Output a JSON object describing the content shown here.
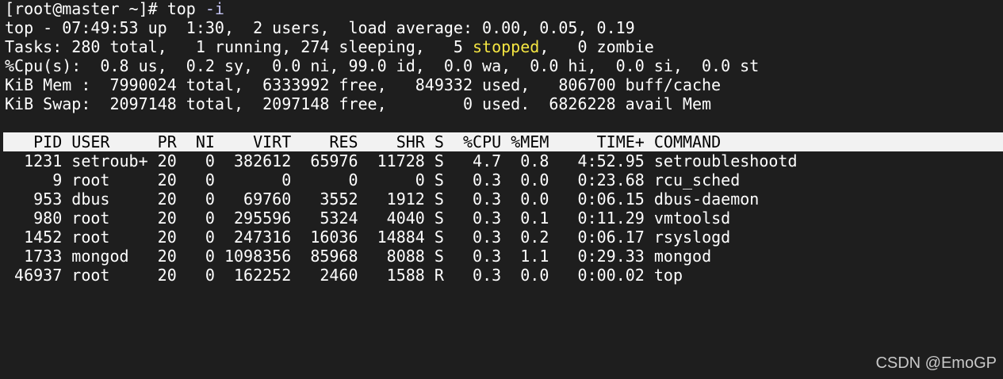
{
  "terminal": {
    "prompt": "[root@master ~]# ",
    "command": "top",
    "command_arg": " -i",
    "summary": {
      "uptime_line": "top - 07:49:53 up  1:30,  2 users,  load average: 0.00, 0.05, 0.19",
      "tasks_prefix": "Tasks: 280 total,   1 running, 274 sleeping,   5 ",
      "tasks_stopped_word": "stopped",
      "tasks_suffix": ",   0 zombie",
      "cpu_line": "%Cpu(s):  0.8 us,  0.2 sy,  0.0 ni, 99.0 id,  0.0 wa,  0.0 hi,  0.0 si,  0.0 st",
      "mem_line": "KiB Mem :  7990024 total,  6333992 free,   849332 used,   806700 buff/cache",
      "swap_line": "KiB Swap:  2097148 total,  2097148 free,        0 used.  6826228 avail Mem"
    },
    "columns": [
      "PID",
      "USER",
      "PR",
      "NI",
      "VIRT",
      "RES",
      "SHR",
      "S",
      "%CPU",
      "%MEM",
      "TIME+",
      "COMMAND"
    ],
    "processes": [
      {
        "pid": "1231",
        "user": "setroub+",
        "pr": "20",
        "ni": "0",
        "virt": "382612",
        "res": "65976",
        "shr": "11728",
        "s": "S",
        "cpu": "4.7",
        "mem": "0.8",
        "time": "4:52.95",
        "command": "setroubleshootd"
      },
      {
        "pid": "9",
        "user": "root",
        "pr": "20",
        "ni": "0",
        "virt": "0",
        "res": "0",
        "shr": "0",
        "s": "S",
        "cpu": "0.3",
        "mem": "0.0",
        "time": "0:23.68",
        "command": "rcu_sched"
      },
      {
        "pid": "953",
        "user": "dbus",
        "pr": "20",
        "ni": "0",
        "virt": "69760",
        "res": "3552",
        "shr": "1912",
        "s": "S",
        "cpu": "0.3",
        "mem": "0.0",
        "time": "0:06.15",
        "command": "dbus-daemon"
      },
      {
        "pid": "980",
        "user": "root",
        "pr": "20",
        "ni": "0",
        "virt": "295596",
        "res": "5324",
        "shr": "4040",
        "s": "S",
        "cpu": "0.3",
        "mem": "0.1",
        "time": "0:11.29",
        "command": "vmtoolsd"
      },
      {
        "pid": "1452",
        "user": "root",
        "pr": "20",
        "ni": "0",
        "virt": "247316",
        "res": "16036",
        "shr": "14884",
        "s": "S",
        "cpu": "0.3",
        "mem": "0.2",
        "time": "0:06.17",
        "command": "rsyslogd"
      },
      {
        "pid": "1733",
        "user": "mongod",
        "pr": "20",
        "ni": "0",
        "virt": "1098356",
        "res": "85968",
        "shr": "8088",
        "s": "S",
        "cpu": "0.3",
        "mem": "1.1",
        "time": "0:29.33",
        "command": "mongod"
      },
      {
        "pid": "46937",
        "user": "root",
        "pr": "20",
        "ni": "0",
        "virt": "162252",
        "res": "2460",
        "shr": "1588",
        "s": "R",
        "cpu": "0.3",
        "mem": "0.0",
        "time": "0:00.02",
        "command": "top"
      }
    ]
  },
  "watermark": "CSDN @EmoGP",
  "colors": {
    "background": "#1e1e1e",
    "foreground": "#ffffff",
    "header_bg": "#f2f2f2",
    "stopped_highlight": "#f5e642"
  }
}
